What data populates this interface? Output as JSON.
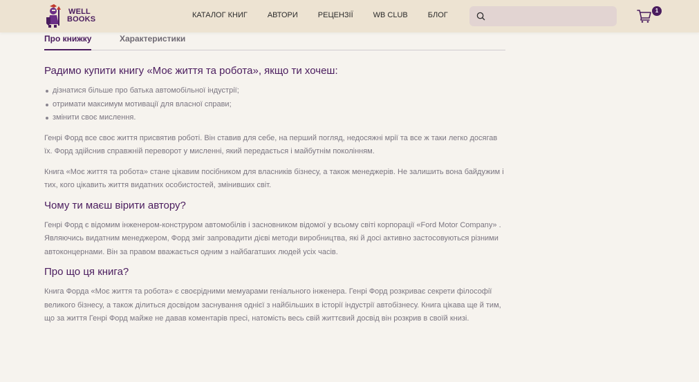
{
  "brand": {
    "line1": "WELL",
    "line2": "BOOKS"
  },
  "nav": [
    "КАТАЛОГ КНИГ",
    "АВТОРИ",
    "РЕЦЕНЗІЇ",
    "WB CLUB",
    "БЛОГ"
  ],
  "search": {
    "placeholder": "",
    "value": ""
  },
  "cart": {
    "count": "1"
  },
  "tabs": [
    "Про книжку",
    "Характеристики"
  ],
  "colors": {
    "brand": "#4a1c5e",
    "header_bg": "#ede3d2",
    "page_bg": "#f6f3ee",
    "search_bg": "#e2d4d2"
  },
  "article": {
    "h1": "Радимо купити книгу «Моє життя та робота», якщо ти хочеш:",
    "bullets": [
      "дізнатися більше про батька автомобільної індустрії;",
      "отримати максимум мотивації для власної справи;",
      "змінити своє мислення."
    ],
    "p1": "Генрі Форд все своє життя присвятив роботі. Він ставив для себе, на перший погляд, недосяжні мрії та все ж таки легко досягав їх. Форд здійснив справжній переворот у мисленні, який передається і майбутнім поколінням.",
    "p2": "Книга «Моє життя та робота» стане цікавим посібником для власників бізнесу, а також менеджерів. Не залишить вона байдужим і тих, кого цікавить життя видатних особистостей, змінивших світ.",
    "h2": "Чому ти маєш вірити автору?",
    "p3": "Генрі Форд є відомим інженером-конструром автомобілів і засновником відомої у всьому світі корпорації «Ford Motor Company» . Являючись видатним менеджером, Форд зміг запровадити дієві методи виробництва, які й досі активно застосовуються різними автоконцернами. Він за правом вважається одним з найбагатших людей усіх часів.",
    "h3": "Про що ця книга?",
    "p4": "Книга Форда «Моє життя та робота» є своєрідними мемуарами геніального інженера. Генрі Форд розкриває секрети філософії великого бізнесу, а також ділиться досвідом заснування однієї з найбільших в історії індустрії автобізнесу. Книга цікава ще й тим, що за життя Генрі Форд майже не давав коментарів пресі, натомість весь свій життєвий досвід він розкрив в своїй книзі."
  }
}
